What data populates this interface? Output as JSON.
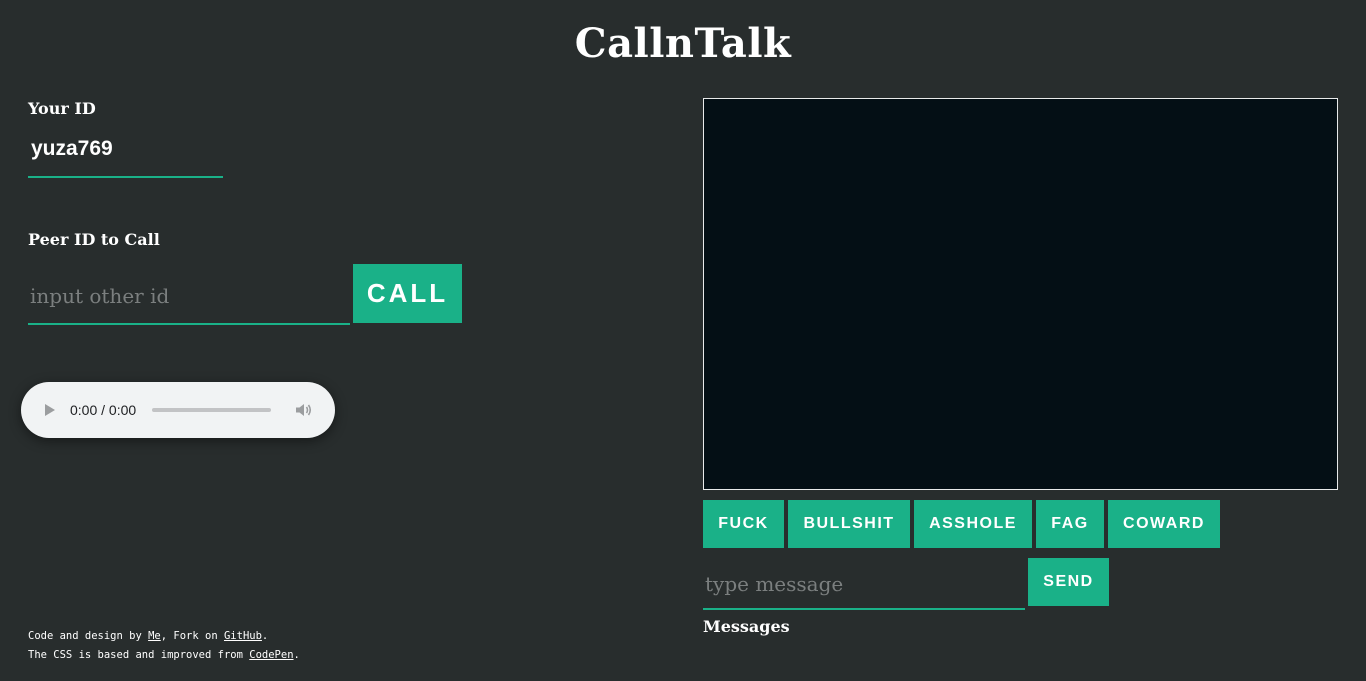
{
  "header": {
    "title": "CallnTalk"
  },
  "your_id": {
    "label": "Your ID",
    "value": "yuza769"
  },
  "peer": {
    "label": "Peer ID to Call",
    "placeholder": "input other id",
    "call_label": "CALL"
  },
  "audio": {
    "time": "0:00 / 0:00",
    "progress": 0
  },
  "phrases": [
    "FUCK",
    "BULLSHIT",
    "ASSHOLE",
    "FAG",
    "COWARD"
  ],
  "chat": {
    "placeholder": "type message",
    "send_label": "SEND",
    "messages_label": "Messages"
  },
  "footer": {
    "line1_prefix": "Code and design by ",
    "line1_link1": "Me",
    "line1_mid": ", Fork on ",
    "line1_link2": "GitHub",
    "line1_suffix": ".",
    "line2_prefix": "The CSS is based and improved from ",
    "line2_link": "CodePen",
    "line2_suffix": "."
  },
  "colors": {
    "background": "#282d2d",
    "accent": "#1ab188",
    "video_bg": "#040f15"
  },
  "icons": {
    "play": "play-icon",
    "volume": "volume-icon"
  }
}
